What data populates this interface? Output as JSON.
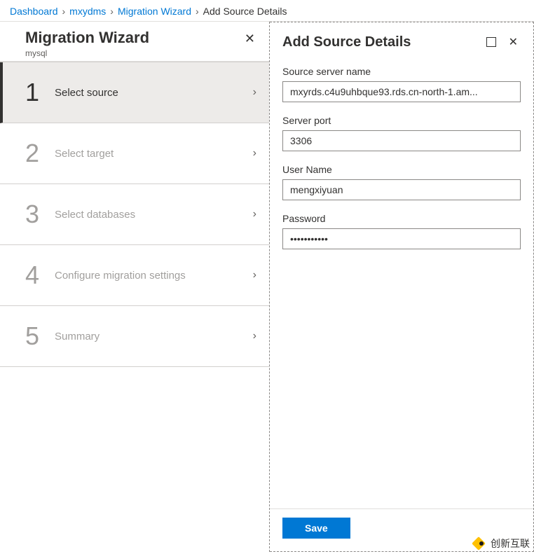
{
  "breadcrumb": {
    "items": [
      {
        "label": "Dashboard"
      },
      {
        "label": "mxydms"
      },
      {
        "label": "Migration Wizard"
      },
      {
        "label": "Add Source Details"
      }
    ]
  },
  "wizard": {
    "title": "Migration Wizard",
    "subtitle": "mysql",
    "steps": [
      {
        "num": "1",
        "label": "Select source",
        "active": true
      },
      {
        "num": "2",
        "label": "Select target",
        "active": false
      },
      {
        "num": "3",
        "label": "Select databases",
        "active": false
      },
      {
        "num": "4",
        "label": "Configure migration settings",
        "active": false
      },
      {
        "num": "5",
        "label": "Summary",
        "active": false
      }
    ]
  },
  "panel": {
    "title": "Add Source Details",
    "fields": {
      "server_name": {
        "label": "Source server name",
        "value": "mxyrds.c4u9uhbque93.rds.cn-north-1.am..."
      },
      "server_port": {
        "label": "Server port",
        "value": "3306"
      },
      "user_name": {
        "label": "User Name",
        "value": "mengxiyuan"
      },
      "password": {
        "label": "Password",
        "value": "•••••••••••"
      }
    },
    "save_label": "Save"
  },
  "watermark": {
    "text": "创新互联"
  }
}
